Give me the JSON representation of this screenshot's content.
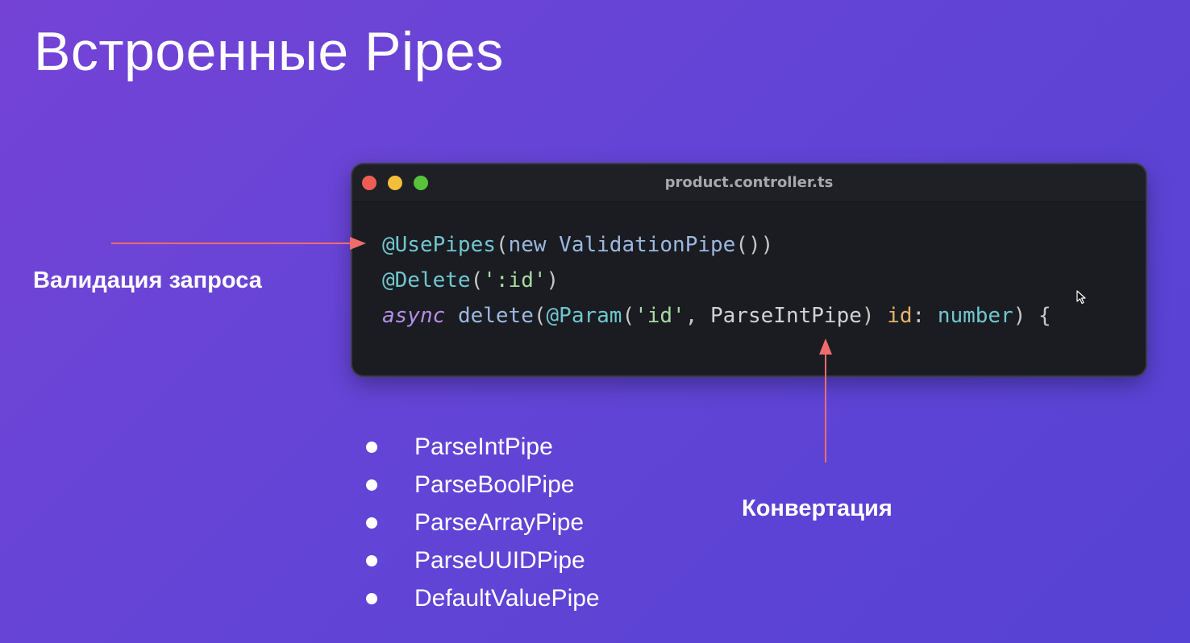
{
  "slide": {
    "title": "Встроенные Pipes"
  },
  "code_window": {
    "filename": "product.controller.ts",
    "lines": [
      [
        {
          "text": "@UsePipes",
          "kind": "decorator"
        },
        {
          "text": "(",
          "kind": "punct"
        },
        {
          "text": "new ",
          "kind": "fn"
        },
        {
          "text": "ValidationPipe",
          "kind": "fn"
        },
        {
          "text": "())",
          "kind": "punct"
        }
      ],
      [
        {
          "text": "@Delete",
          "kind": "decorator"
        },
        {
          "text": "(",
          "kind": "punct"
        },
        {
          "text": "':id'",
          "kind": "string"
        },
        {
          "text": ")",
          "kind": "punct"
        }
      ],
      [
        {
          "text": "async",
          "kind": "keyword"
        },
        {
          "text": " ",
          "kind": "plain"
        },
        {
          "text": "delete",
          "kind": "fn"
        },
        {
          "text": "(",
          "kind": "punct"
        },
        {
          "text": "@Param",
          "kind": "decorator"
        },
        {
          "text": "(",
          "kind": "punct"
        },
        {
          "text": "'id'",
          "kind": "string"
        },
        {
          "text": ", ",
          "kind": "punct"
        },
        {
          "text": "ParseIntPipe",
          "kind": "plain"
        },
        {
          "text": ") ",
          "kind": "punct"
        },
        {
          "text": "id",
          "kind": "param"
        },
        {
          "text": ": ",
          "kind": "punct"
        },
        {
          "text": "number",
          "kind": "type"
        },
        {
          "text": ") {",
          "kind": "punct"
        }
      ]
    ]
  },
  "labels": {
    "validation": "Валидация запроса",
    "conversion": "Конвертация"
  },
  "pipes_list": [
    "ParseIntPipe",
    "ParseBoolPipe",
    "ParseArrayPipe",
    "ParseUUIDPipe",
    "DefaultValuePipe"
  ],
  "colors": {
    "arrow": "#ef6c6c",
    "background_start": "#7443d6",
    "background_end": "#5642d4"
  },
  "icons": {
    "cursor": "mouse-pointer-icon"
  }
}
